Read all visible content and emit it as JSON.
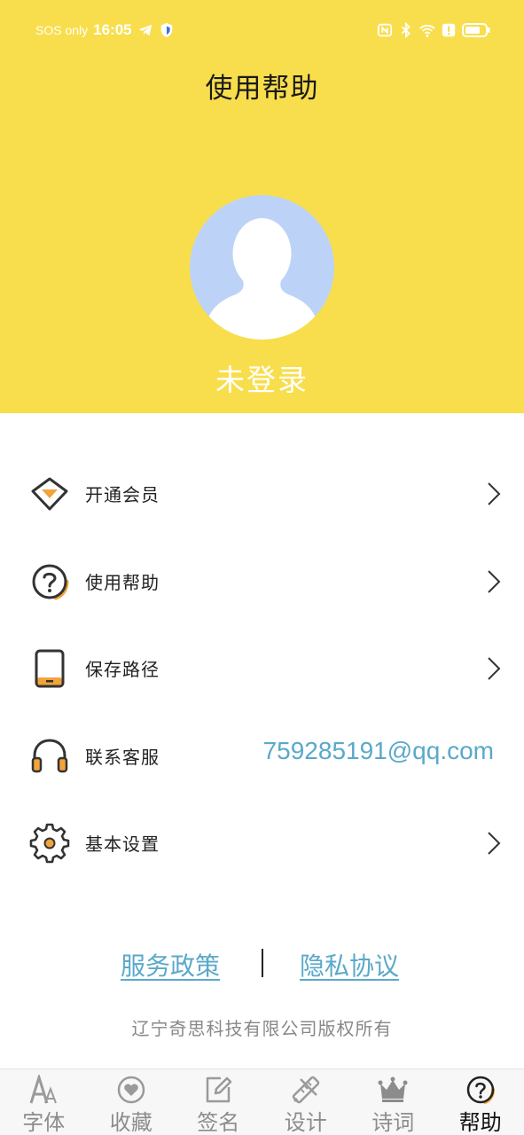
{
  "status_bar": {
    "sos": "SOS only",
    "time": "16:05"
  },
  "header": {
    "title": "使用帮助",
    "login_status": "未登录",
    "colors": {
      "background": "#f8de4c",
      "avatar_bg": "#bcd3f7"
    }
  },
  "menu": {
    "items": [
      {
        "label": "开通会员",
        "icon": "vip-diamond-icon"
      },
      {
        "label": "使用帮助",
        "icon": "help-circle-icon"
      },
      {
        "label": "保存路径",
        "icon": "tablet-icon"
      },
      {
        "label": "联系客服",
        "icon": "headphones-icon",
        "value": "759285191@qq.com"
      },
      {
        "label": "基本设置",
        "icon": "gear-icon"
      }
    ]
  },
  "footer": {
    "service_policy": "服务政策",
    "privacy_agreement": "隐私协议",
    "copyright": "辽宁奇思科技有限公司版权所有"
  },
  "bottom_nav": {
    "items": [
      {
        "label": "字体",
        "icon": "font-icon"
      },
      {
        "label": "收藏",
        "icon": "heart-icon"
      },
      {
        "label": "签名",
        "icon": "edit-icon"
      },
      {
        "label": "设计",
        "icon": "design-tools-icon"
      },
      {
        "label": "诗词",
        "icon": "crown-icon"
      },
      {
        "label": "帮助",
        "icon": "help-icon",
        "active": true
      }
    ]
  },
  "colors": {
    "accent_orange": "#f2a33a",
    "link_blue": "#5aa9c9"
  }
}
